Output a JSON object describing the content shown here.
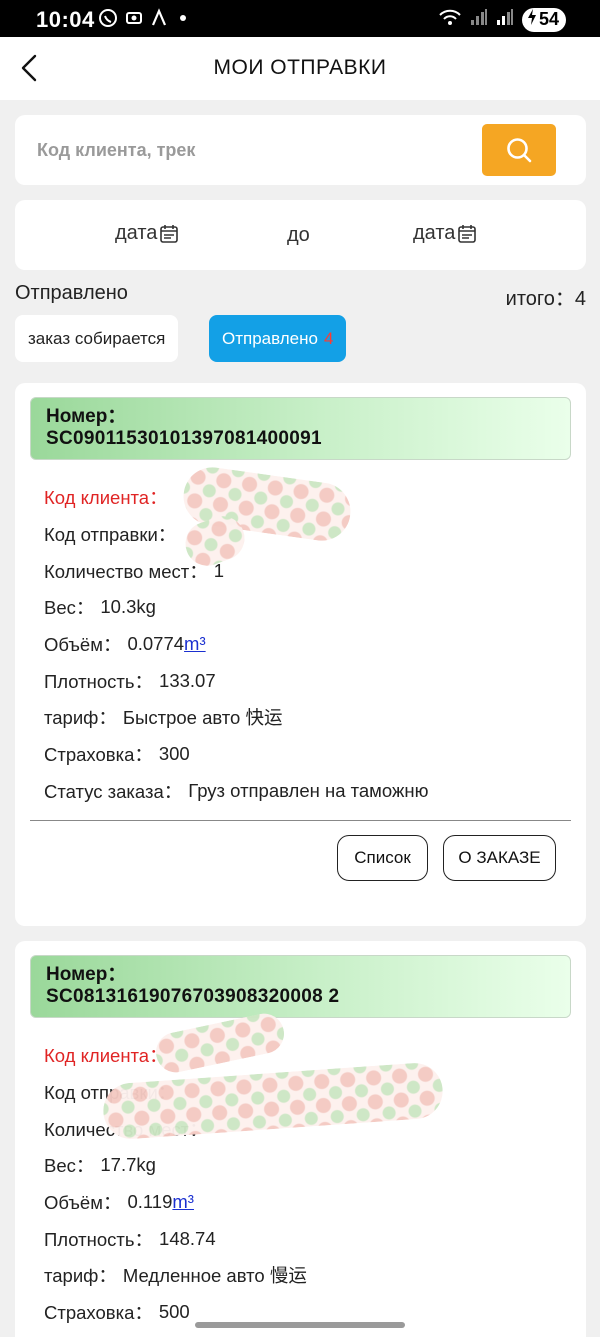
{
  "status_bar": {
    "time": "10:04",
    "battery": "54",
    "icons": [
      "whatsapp-icon",
      "screenshot-icon",
      "app-icon",
      "wifi-icon",
      "signal-icon",
      "signal-icon",
      "battery-icon"
    ]
  },
  "header": {
    "title": "МОИ ОТПРАВКИ"
  },
  "search": {
    "placeholder": "Код клиента, трек"
  },
  "date_range": {
    "from": "дата",
    "to_label": "до",
    "to": "дата"
  },
  "status": {
    "label": "Отправлено",
    "total": "итого：4"
  },
  "tabs": [
    {
      "label": "заказ собирается",
      "count": ""
    },
    {
      "label": "Отправлено",
      "count": "4"
    }
  ],
  "orders": [
    {
      "number_label": "Номер：",
      "number": "SC09011530101397081400091",
      "client_label": "Код клиента：",
      "ship_label": "Код отправки：",
      "places_label": "Количество мест：",
      "places": "1",
      "weight_label": "Вес：",
      "weight": "10.3kg",
      "volume_label": "Объём：",
      "volume": "0.0774",
      "volume_unit": "m³",
      "density_label": "Плотность：",
      "density": "133.07",
      "tariff_label": "тариф：",
      "tariff": "Быстрое авто 快运",
      "insurance_label": "Страховка：",
      "insurance": "300",
      "status_label": "Статус заказа：",
      "status": "Груз отправлен на таможню",
      "btn_list": "Список",
      "btn_detail": "О ЗАКАЗЕ"
    },
    {
      "number_label": "Номер：",
      "number": "SC08131619076703908320008 2",
      "client_label": "Код клиента：",
      "ship_label": "Код отправки：",
      "places_label": "Количество мест：",
      "weight_label": "Вес：",
      "weight": "17.7kg",
      "volume_label": "Объём：",
      "volume": "0.119",
      "volume_unit": "m³",
      "density_label": "Плотность：",
      "density": "148.74",
      "tariff_label": "тариф：",
      "tariff": "Медленное авто 慢运",
      "insurance_label": "Страховка：",
      "insurance": "500"
    }
  ]
}
